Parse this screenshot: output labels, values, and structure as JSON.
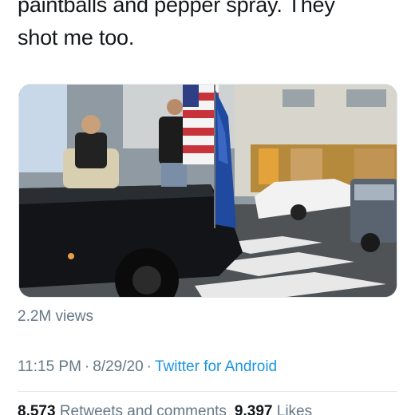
{
  "tweet": {
    "text_lines": [
      "paintballs and pepper spray. They",
      "shot me too."
    ]
  },
  "media": {
    "description_icon": "video-thumbnail-icon"
  },
  "views": "2.2M views",
  "meta": {
    "time": "11:15 PM",
    "separator": "·",
    "date": "8/29/20",
    "source": "Twitter for Android"
  },
  "stats": {
    "retweets_count": "8,573",
    "retweets_label": "Retweets and comments",
    "likes_count": "9,397",
    "likes_label": "Likes"
  },
  "colors": {
    "text": "#14171a",
    "secondary": "#657786",
    "link": "#1b95e0",
    "divider": "#e1e8ed"
  }
}
